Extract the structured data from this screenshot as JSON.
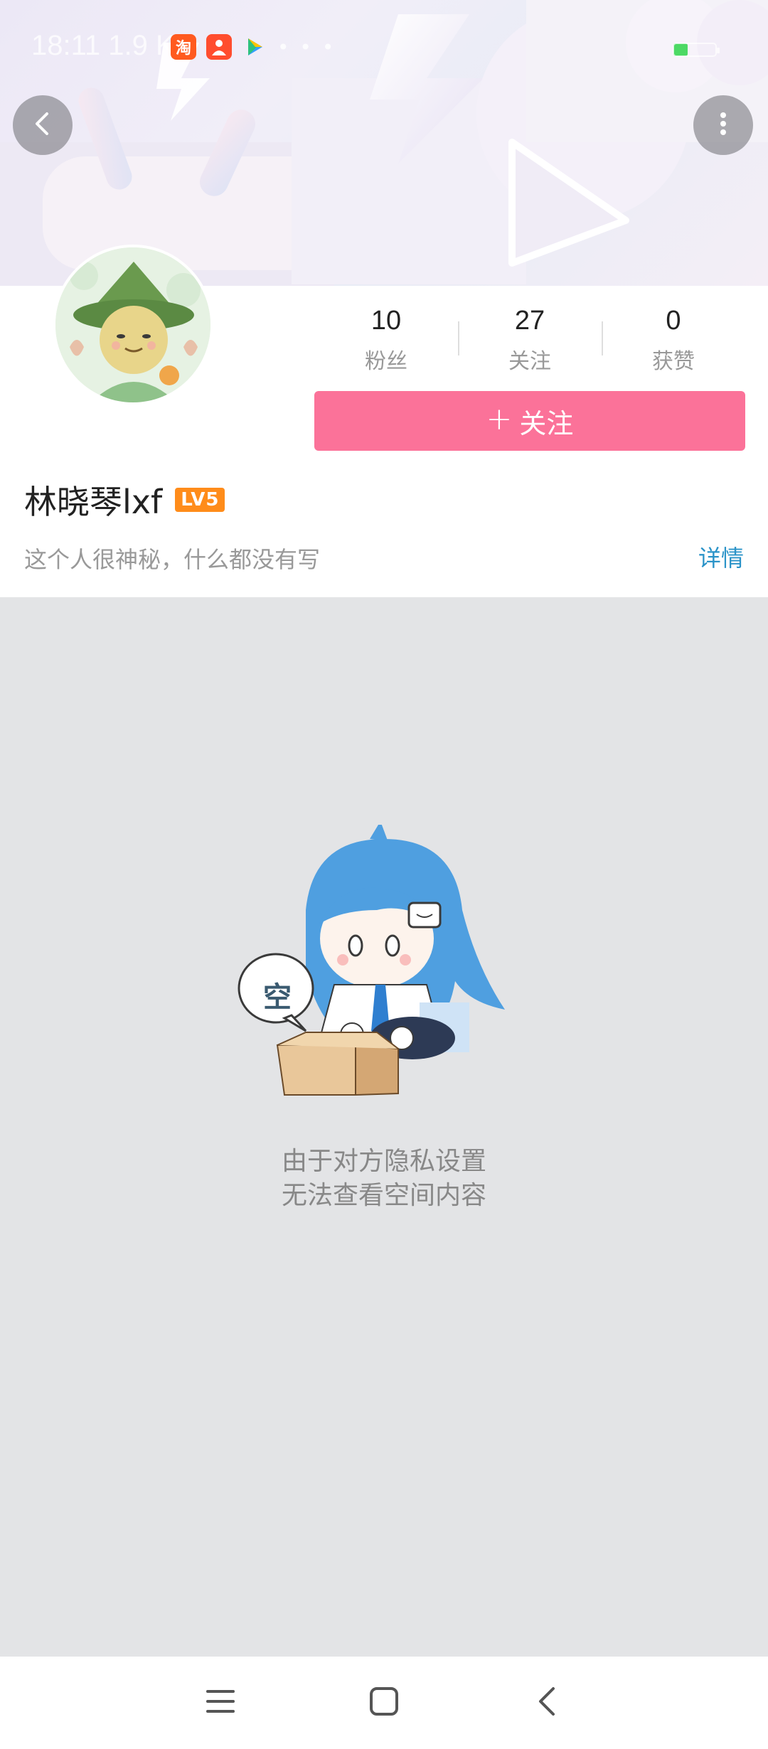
{
  "status_bar": {
    "time": "18:11 1.9 K/s",
    "app_icons": [
      "taobao-app-icon",
      "people-app-icon",
      "play-store-icon"
    ],
    "more_dots": "• • •",
    "battery_level": "4"
  },
  "header": {
    "back_icon": "chevron-left-icon",
    "more_icon": "vertical-dots-icon"
  },
  "profile": {
    "username": "林晓琴lxf",
    "level_badge": "LV5",
    "bio": "这个人很神秘，什么都没有写",
    "detail_link": "详情",
    "stats": [
      {
        "value": "10",
        "label": "粉丝"
      },
      {
        "value": "27",
        "label": "关注"
      },
      {
        "value": "0",
        "label": "获赞"
      }
    ],
    "follow_button": {
      "plus": "+",
      "label": "关注"
    }
  },
  "empty_state": {
    "speech_bubble": "空",
    "line1": "由于对方隐私设置",
    "line2": "无法查看空间内容"
  },
  "nav_bar": {
    "icons": [
      "menu-icon",
      "home-icon",
      "back-icon"
    ]
  },
  "colors": {
    "accent_pink": "#fb7299",
    "link_blue": "#2a93c8",
    "level_orange": "#ff8c1a",
    "empty_bg": "#e3e4e6"
  }
}
